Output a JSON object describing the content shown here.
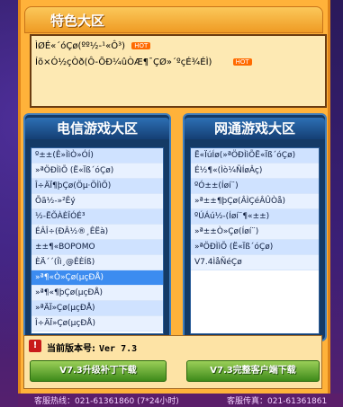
{
  "featured": {
    "title": "特色大区",
    "lines": [
      "ÌØÉ«´óÇø(ºº½-¹«Ô³)",
      "Íõ×Ó½çÒð(Ô-ÕÐ¼ûÒÆ¶¯ÇØ»´ºçÉ¾ÉÌ)"
    ],
    "hot_label": "HOT"
  },
  "telecom": {
    "title": "电信游戏大区",
    "items": [
      "º±±(Ê»ÌìÒ»ÓÍ)",
      "»ªÖÐÌìÕ (Ë«Ïß´óÇø)",
      "Î÷ÄÏ¶þÇø(Öµ·ÖÌìÕ)",
      "Õã½-»²Êý",
      "½-ËÕÀÈÎÓÉ³",
      "ÉÂÎ÷(ÐÂ½®¸ÊËà)",
      "±±¶«BOPOMO",
      "ÈÄ´´(Îì¸@ÊÈÍß)",
      "»ª¶«Ò»Çø(µçÐÅ)",
      "»ª¶«¶þÇø(µçÐÅ)",
      "»ªÄÏ»Çø(µçÐÅ)",
      "Î÷ÄÏ»Çø(µçÐÅ)"
    ],
    "selected_index": 8
  },
  "netcom": {
    "title": "网通游戏大区",
    "items": [
      "Ë«ÏúÍø(»ªÖÐÌìÕË«Ïß´óÇø)",
      "É½¶«(Ìò¼ÑÍøÂç)",
      "ºÓ±±(Íøí¨)",
      "»ª±±¶þÇø(ÂÌÇéÂÛÒå)",
      "ºÚÁú½-(Íøí¨¶«±±)",
      "»ª±±Ò»Çø(Íøí¨)",
      "»ªÖÐÌìÕ (Ë«Ïß´óÇø)",
      "V7.4ÌåÑéÇø"
    ]
  },
  "version": {
    "label": "当前版本号:",
    "value": "Ver 7.3",
    "patch_button": "V7.3升级补丁下载",
    "full_button": "V7.3完整客户端下载"
  },
  "footer": {
    "left": "客服热线：021-61361860 (7*24小时)",
    "right": "客服传真：021-61361861"
  }
}
